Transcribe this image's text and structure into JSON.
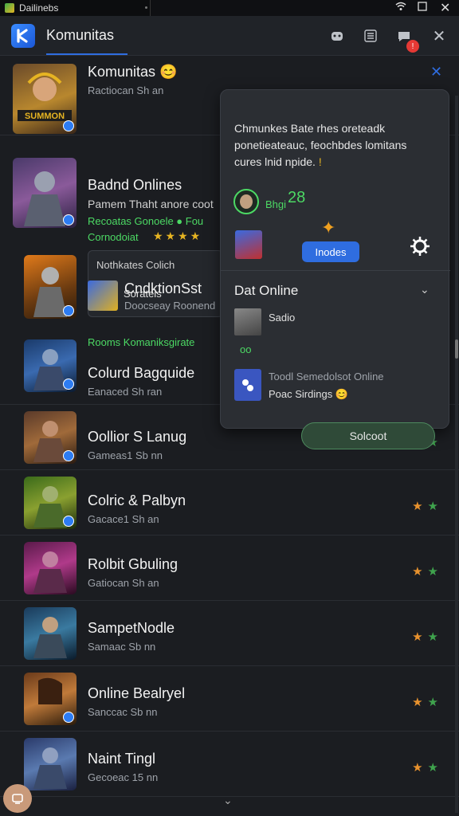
{
  "statusbar": {
    "app_name": "Dailinebs"
  },
  "header": {
    "title": "Komunitas"
  },
  "notification_count": "!",
  "rows": [
    {
      "name": "Komunitas 😊",
      "sub": "Ractiocan Sh an"
    },
    {
      "name": "Badnd Onlines",
      "sub": "Pamem Thaht anore coot",
      "line3": "Recoatas Gonoele ● Fou",
      "line4": "Cornodoiat"
    },
    {
      "name": "CndktionSst",
      "sub": "Doocseay Roonend"
    },
    {
      "name": "Colurd Bagquide",
      "sub": "Eanaced Sh ran",
      "label_above": "Rooms Komaniksgirate"
    },
    {
      "name": "Oollior S Lanug",
      "sub": "Gameas1 Sb nn"
    },
    {
      "name": "Colric & Palbyn",
      "sub": "Gacace1 Sh an"
    },
    {
      "name": "Rolbit Gbuling",
      "sub": "Gatiocan Sh an"
    },
    {
      "name": "SampetNodle",
      "sub": "Samaac Sb nn"
    },
    {
      "name": "Online Bealryel",
      "sub": "Sanccac Sb nn"
    },
    {
      "name": "Naint Tingl",
      "sub": "Gecoeac 15 nn"
    }
  ],
  "subcard": {
    "title": "Nothkates Colich",
    "item": "Sorateis"
  },
  "popup": {
    "text_line1": "Chmunkes Bate rhes  oreteadk",
    "text_line2": "ponetieateauc, feochbdes lomitans",
    "text_line3": "cures lnid npide.",
    "text_mark": "!",
    "user_label": "Bhgi",
    "user_score": "28",
    "action_button": "Inodes",
    "section_title": "Dat Online",
    "item1": "Sadio",
    "item1_sub": "oo",
    "item2_title": "Toodl Semedolsot Online",
    "item2_sub": "Poac Sirdings 😊"
  },
  "save_button": "Solcoot",
  "colors": {
    "accent": "#2f6de0",
    "badge": "#e53935",
    "star_orange": "#e8922e",
    "star_green": "#3fa34d",
    "online_green": "#4cd964"
  }
}
